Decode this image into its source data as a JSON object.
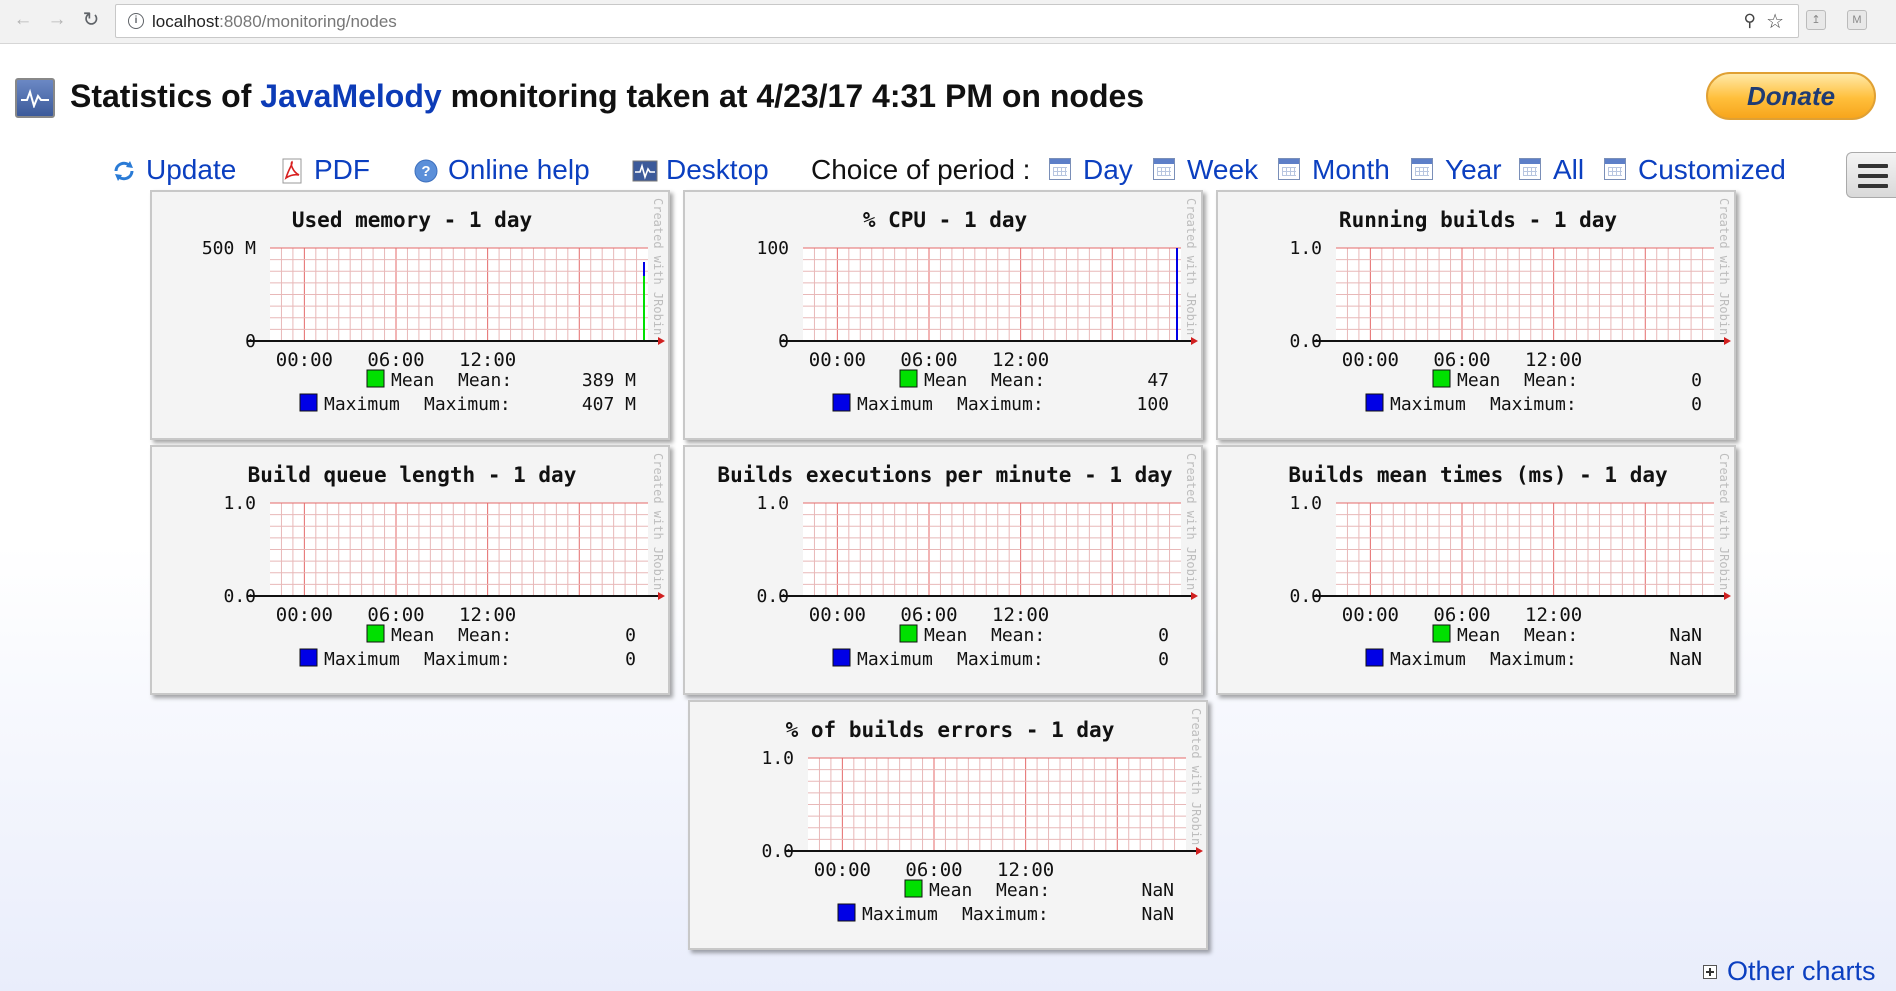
{
  "browser": {
    "url_host": "localhost",
    "url_path": ":8080/monitoring/nodes"
  },
  "header": {
    "title_prefix": "Statistics of ",
    "brand": "JavaMelody",
    "title_suffix": " monitoring taken at 4/23/17 4:31 PM on nodes",
    "donate_label": "Donate"
  },
  "toolbar": {
    "update": "Update",
    "pdf": "PDF",
    "online_help": "Online help",
    "desktop": "Desktop",
    "period_label": "Choice of period :",
    "periods": [
      "Day",
      "Week",
      "Month",
      "Year",
      "All",
      "Customized"
    ]
  },
  "footer": {
    "other_charts": "Other charts"
  },
  "colors": {
    "mean": "#00e000",
    "maximum": "#0000e6",
    "grid_minor": "#e8b8b8",
    "grid_major": "#e46a6a",
    "link": "#0b3fc0"
  },
  "chart_data": [
    {
      "type": "line",
      "title": "Used memory - 1 day",
      "y_ticks": [
        "500 M",
        "0"
      ],
      "x_ticks": [
        "00:00",
        "06:00",
        "12:00"
      ],
      "series": [
        {
          "name": "Mean",
          "label": "Mean:",
          "summary": "389 M"
        },
        {
          "name": "Maximum",
          "label": "Maximum:",
          "summary": "407 M"
        }
      ],
      "watermark": "Created with JRobin",
      "spike": "both"
    },
    {
      "type": "line",
      "title": "% CPU - 1 day",
      "y_ticks": [
        "100",
        "0"
      ],
      "x_ticks": [
        "00:00",
        "06:00",
        "12:00"
      ],
      "series": [
        {
          "name": "Mean",
          "label": "Mean:",
          "summary": "47"
        },
        {
          "name": "Maximum",
          "label": "Maximum:",
          "summary": "100"
        }
      ],
      "watermark": "Created with JRobin",
      "spike": "max"
    },
    {
      "type": "line",
      "title": "Running builds - 1 day",
      "y_ticks": [
        "1.0",
        "0.0"
      ],
      "x_ticks": [
        "00:00",
        "06:00",
        "12:00"
      ],
      "series": [
        {
          "name": "Mean",
          "label": "Mean:",
          "summary": "0"
        },
        {
          "name": "Maximum",
          "label": "Maximum:",
          "summary": "0"
        }
      ],
      "watermark": "Created with JRobin",
      "spike": "none"
    },
    {
      "type": "line",
      "title": "Build queue length - 1 day",
      "y_ticks": [
        "1.0",
        "0.0"
      ],
      "x_ticks": [
        "00:00",
        "06:00",
        "12:00"
      ],
      "series": [
        {
          "name": "Mean",
          "label": "Mean:",
          "summary": "0"
        },
        {
          "name": "Maximum",
          "label": "Maximum:",
          "summary": "0"
        }
      ],
      "watermark": "Created with JRobin",
      "spike": "none"
    },
    {
      "type": "line",
      "title": "Builds executions per minute - 1 day",
      "y_ticks": [
        "1.0",
        "0.0"
      ],
      "x_ticks": [
        "00:00",
        "06:00",
        "12:00"
      ],
      "series": [
        {
          "name": "Mean",
          "label": "Mean:",
          "summary": "0"
        },
        {
          "name": "Maximum",
          "label": "Maximum:",
          "summary": "0"
        }
      ],
      "watermark": "Created with JRobin",
      "spike": "none"
    },
    {
      "type": "line",
      "title": "Builds mean times (ms) - 1 day",
      "y_ticks": [
        "1.0",
        "0.0"
      ],
      "x_ticks": [
        "00:00",
        "06:00",
        "12:00"
      ],
      "series": [
        {
          "name": "Mean",
          "label": "Mean:",
          "summary": "NaN"
        },
        {
          "name": "Maximum",
          "label": "Maximum:",
          "summary": "NaN"
        }
      ],
      "watermark": "Created with JRobin",
      "spike": "none"
    },
    {
      "type": "line",
      "title": "% of builds errors - 1 day",
      "y_ticks": [
        "1.0",
        "0.0"
      ],
      "x_ticks": [
        "00:00",
        "06:00",
        "12:00"
      ],
      "series": [
        {
          "name": "Mean",
          "label": "Mean:",
          "summary": "NaN"
        },
        {
          "name": "Maximum",
          "label": "Maximum:",
          "summary": "NaN"
        }
      ],
      "watermark": "Created with JRobin",
      "spike": "none"
    }
  ]
}
